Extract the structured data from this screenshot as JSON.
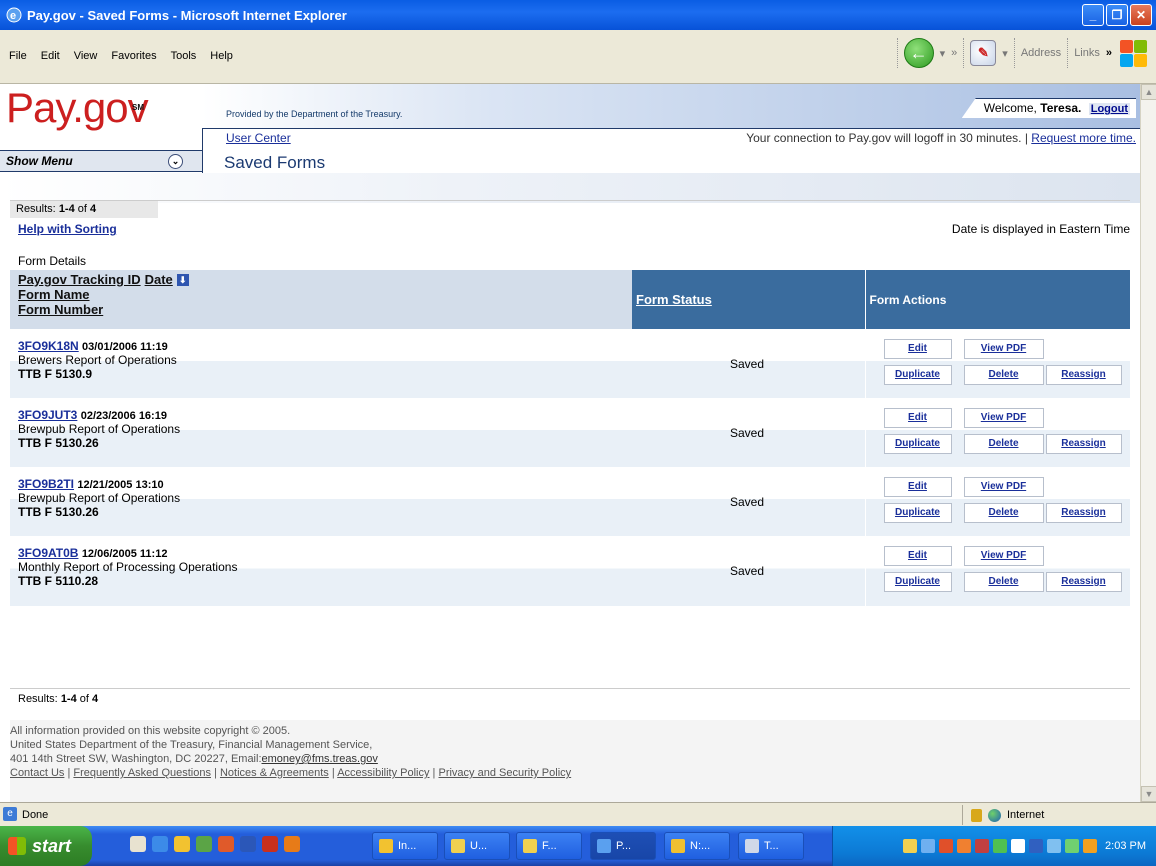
{
  "window": {
    "title": "Pay.gov - Saved Forms - Microsoft Internet Explorer"
  },
  "menu": [
    "File",
    "Edit",
    "View",
    "Favorites",
    "Tools",
    "Help"
  ],
  "toolbar": {
    "address_label": "Address",
    "links_label": "Links",
    "chevrons": "»"
  },
  "header": {
    "logo_text": "Pay.gov",
    "logo_sm": "SM",
    "provided_by": "Provided by the Department of the Treasury.",
    "welcome_prefix": "Welcome,",
    "user_name": "Teresa.",
    "logout": "Logout",
    "user_center": "User Center",
    "logoff_notice": "Your connection to Pay.gov will logoff in 30 minutes. |",
    "request_time": "Request more time.",
    "show_menu": "Show Menu",
    "page_title": "Saved Forms"
  },
  "results": {
    "label_prefix": "Results:",
    "range": "1-4",
    "of": "of",
    "total": "4",
    "help_sorting": "Help with Sorting",
    "timezone_note": "Date is displayed in Eastern Time",
    "form_details": "Form Details"
  },
  "table": {
    "col1": [
      "Pay.gov Tracking ID",
      "Date",
      "Form Name",
      "Form Number"
    ],
    "col2": "Form Status",
    "col3": "Form Actions",
    "rows": [
      {
        "id": "3FO9K18N",
        "date": "03/01/2006 11:19",
        "name": "Brewers Report of Operations",
        "number": "TTB F 5130.9",
        "status": "Saved"
      },
      {
        "id": "3FO9JUT3",
        "date": "02/23/2006 16:19",
        "name": "Brewpub Report of Operations",
        "number": "TTB F 5130.26",
        "status": "Saved"
      },
      {
        "id": "3FO9B2TI",
        "date": "12/21/2005 13:10",
        "name": "Brewpub Report of Operations",
        "number": "TTB F 5130.26",
        "status": "Saved"
      },
      {
        "id": "3FO9AT0B",
        "date": "12/06/2005 11:12",
        "name": "Monthly Report of Processing Operations",
        "number": "TTB F 5110.28",
        "status": "Saved"
      }
    ],
    "actions": {
      "edit": "Edit",
      "view_pdf": "View PDF",
      "duplicate": "Duplicate",
      "delete": "Delete",
      "reassign": "Reassign"
    }
  },
  "footer": {
    "line1": "All information provided on this website copyright © 2005.",
    "line2": "United States Department of the Treasury, Financial Management Service,",
    "line3_prefix": "401 14th Street SW, Washington, DC 20227, Email:",
    "email": "emoney@fms.treas.gov",
    "links": [
      "Contact Us",
      "Frequently Asked Questions",
      "Notices & Agreements",
      "Accessibility Policy",
      "Privacy and Security Policy"
    ]
  },
  "statusbar": {
    "status": "Done",
    "zone": "Internet"
  },
  "taskbar": {
    "start": "start",
    "tasks": [
      "In...",
      "U...",
      "F...",
      "P...",
      "N:...",
      "T..."
    ],
    "clock": "2:03 PM"
  },
  "colors": {
    "titlebar": "#0a5de3",
    "header_blue": "#3a6c9e",
    "logo_red": "#cc1f1f",
    "link": "#1a2f9a"
  }
}
